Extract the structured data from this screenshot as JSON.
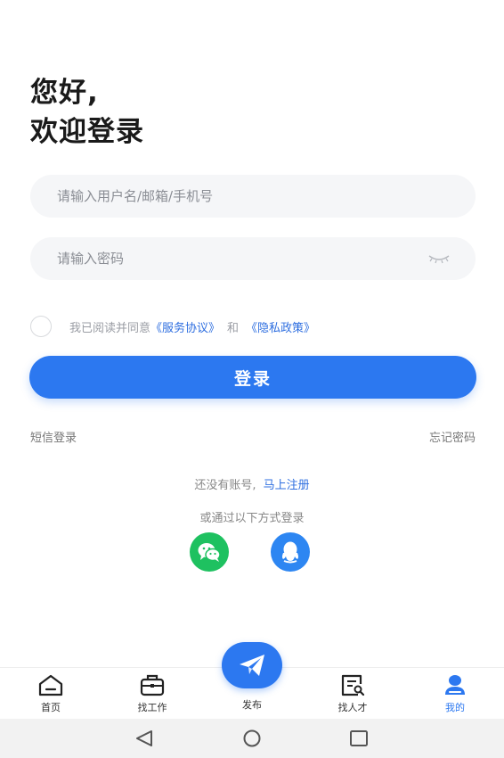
{
  "greeting": {
    "line1": "您好,",
    "line2": "欢迎登录"
  },
  "form": {
    "username_placeholder": "请输入用户名/邮箱/手机号",
    "password_placeholder": "请输入密码",
    "username_value": "",
    "password_value": ""
  },
  "agreement": {
    "prefix": "我已阅读并同意",
    "service_link": "《服务协议》",
    "and": "和",
    "privacy_link": "《隐私政策》",
    "checked": false
  },
  "login_button": "登录",
  "sms_login": "短信登录",
  "forgot_password": "忘记密码",
  "register": {
    "prompt": "还没有账号,",
    "link": "马上注册"
  },
  "other_methods": "或通过以下方式登录",
  "social": [
    {
      "name": "wechat",
      "icon": "wechat-icon",
      "color": "#1ec160"
    },
    {
      "name": "qq",
      "icon": "qq-icon",
      "color": "#2d86f2"
    }
  ],
  "tabbar": {
    "home": "首页",
    "jobs": "找工作",
    "publish": "发布",
    "talent": "找人才",
    "mine": "我的",
    "active": "mine"
  },
  "colors": {
    "accent": "#2c78f0",
    "wechat": "#1ec160",
    "qq": "#2d86f2"
  }
}
